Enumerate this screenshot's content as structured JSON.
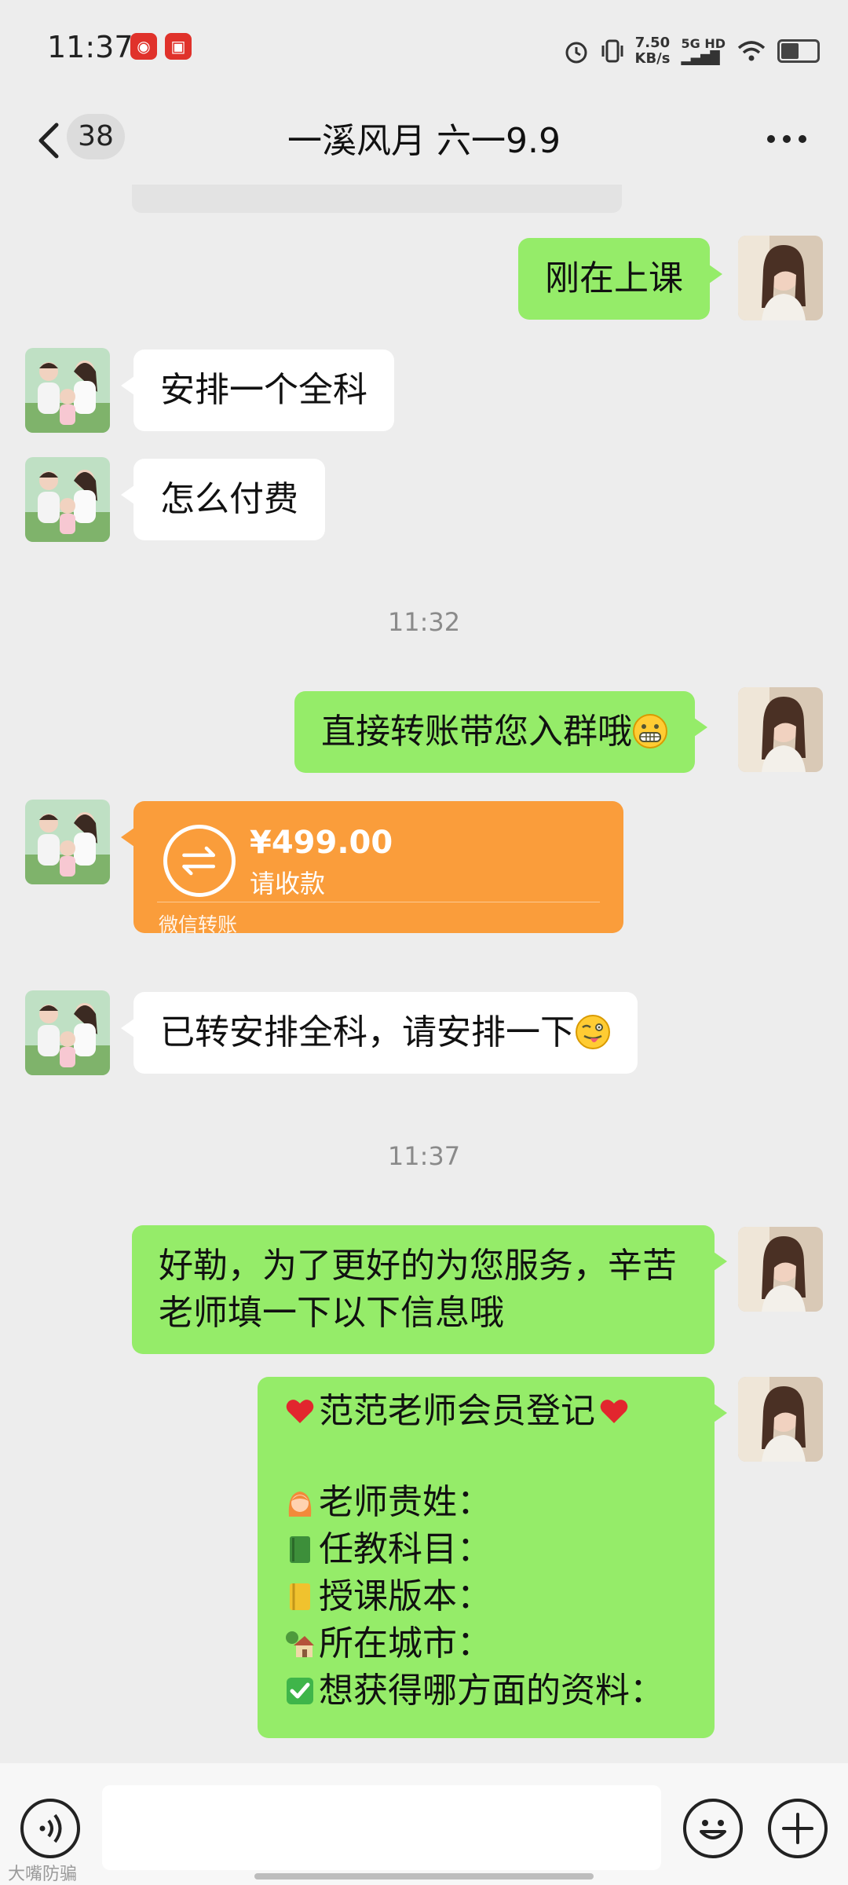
{
  "status_bar": {
    "time": "11:37",
    "net_speed": "7.50",
    "net_unit": "KB/s",
    "net_type": "5G HD",
    "icons": [
      "app-notification-icon",
      "app-notification-icon",
      "alarm-icon",
      "vibrate-icon",
      "signal-icon",
      "wifi-icon",
      "battery-icon"
    ]
  },
  "nav": {
    "unread_count": "38",
    "title": "一溪风月 六一9.9",
    "back_icon": "chevron-left-icon",
    "more_icon": "more-icon"
  },
  "messages": [
    {
      "side": "right",
      "type": "text",
      "text": "刚在上课"
    },
    {
      "side": "left",
      "type": "text",
      "text": "安排一个全科"
    },
    {
      "side": "left",
      "type": "text",
      "text": "怎么付费"
    },
    {
      "type": "time",
      "text": "11:32"
    },
    {
      "side": "right",
      "type": "text",
      "text": "直接转账带您入群哦",
      "emoji": "grin-emoji"
    },
    {
      "side": "left",
      "type": "transfer",
      "amount": "¥499.00",
      "desc": "请收款",
      "footer": "微信转账"
    },
    {
      "side": "left",
      "type": "text",
      "text": "已转安排全科，请安排一下",
      "emoji": "wink-tongue-emoji"
    },
    {
      "type": "time",
      "text": "11:37"
    },
    {
      "side": "right",
      "type": "text",
      "lines": [
        "好勒，为了更好的为您服务，辛苦",
        "老师填一下以下信息哦"
      ]
    },
    {
      "side": "right",
      "type": "form",
      "title": "范范老师会员登记",
      "lines": [
        {
          "icon": "woman-emoji",
          "text": "老师贵姓："
        },
        {
          "icon": "green-book-emoji",
          "text": "任教科目："
        },
        {
          "icon": "ledger-emoji",
          "text": "授课版本："
        },
        {
          "icon": "house-emoji",
          "text": "所在城市："
        },
        {
          "icon": "check-mark-emoji",
          "text": "想获得哪方面的资料："
        }
      ]
    }
  ],
  "colors": {
    "chat_bg": "#ededed",
    "my_bubble": "#95ec69",
    "their_bubble": "#ffffff",
    "transfer_orange": "#fa9d3b"
  },
  "input_bar": {
    "voice_icon": "voice-icon",
    "emoji_icon": "emoji-icon",
    "plus_icon": "plus-icon",
    "value": ""
  },
  "watermark": "大嘴防骗"
}
